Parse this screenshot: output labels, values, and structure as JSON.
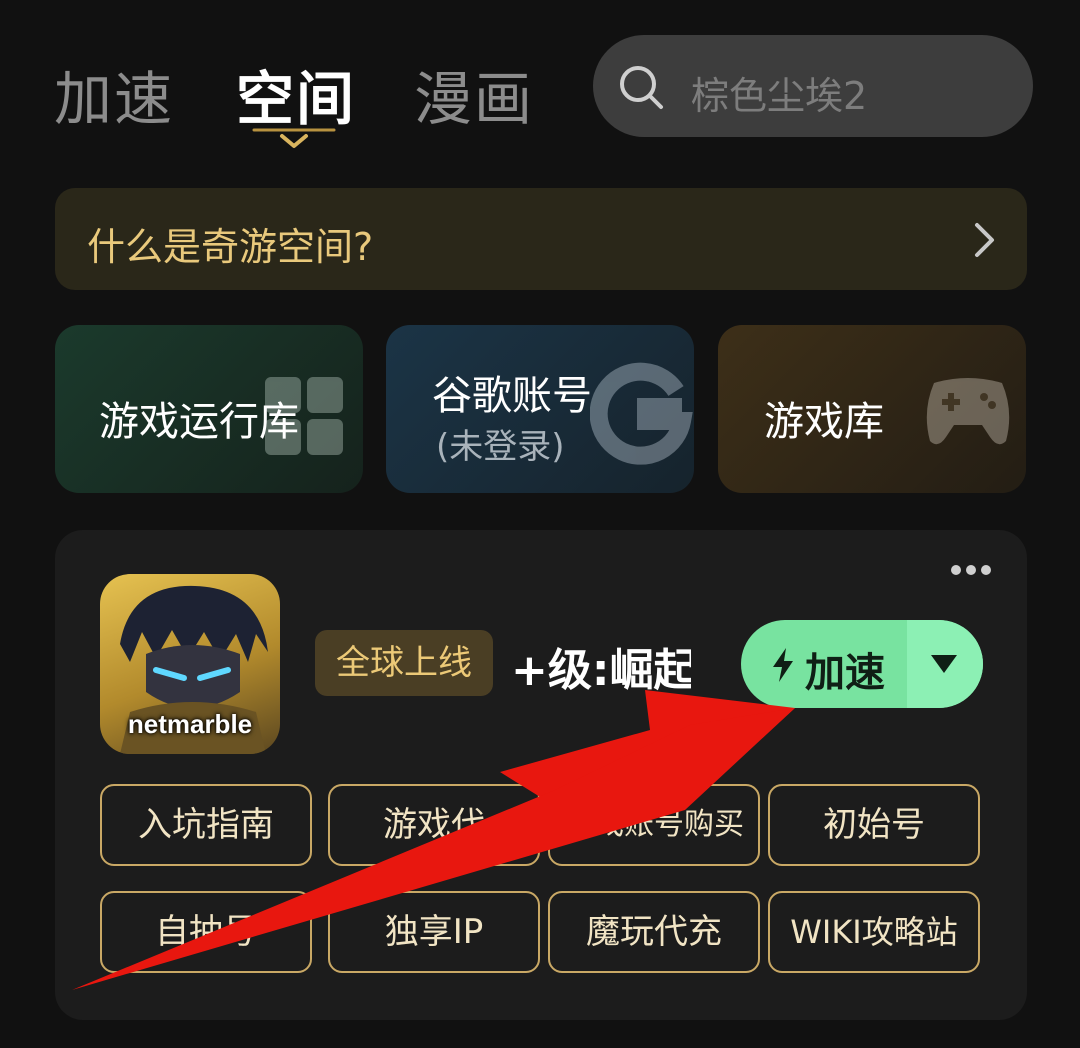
{
  "top_tabs": [
    {
      "label": "加速",
      "active": false
    },
    {
      "label": "空间",
      "active": true
    },
    {
      "label": "漫画",
      "active": false
    }
  ],
  "search": {
    "placeholder": "棕色尘埃2",
    "icon": "search-icon"
  },
  "banner": {
    "text": "什么是奇游空间?",
    "icon": "chevron-right-icon"
  },
  "feature_cards": [
    {
      "label": "游戏运行库",
      "sublabel": "",
      "icon": "puzzle-icon"
    },
    {
      "label": "谷歌账号",
      "sublabel": "(未登录)",
      "icon": "google-g-icon"
    },
    {
      "label": "游戏库",
      "sublabel": "",
      "icon": "gamepad-icon"
    }
  ],
  "game": {
    "icon_brand": "netmarble",
    "badge": "全球上线",
    "title_visible": "+级:崛起",
    "accelerate_label": "加速",
    "more_icon": "more-dots-icon"
  },
  "chips": [
    {
      "label": "入坑指南"
    },
    {
      "label": "游戏代"
    },
    {
      "label": "游戏账号购买"
    },
    {
      "label": "初始号"
    },
    {
      "label": "自抽号"
    },
    {
      "label": "独享IP"
    },
    {
      "label": "魔玩代充"
    },
    {
      "label": "WIKI攻略站"
    }
  ],
  "colors": {
    "background": "#111111",
    "accent_gold": "#e9c97c",
    "accelerate_green": "#78e3a0",
    "overlay_arrow": "#e8170f"
  }
}
